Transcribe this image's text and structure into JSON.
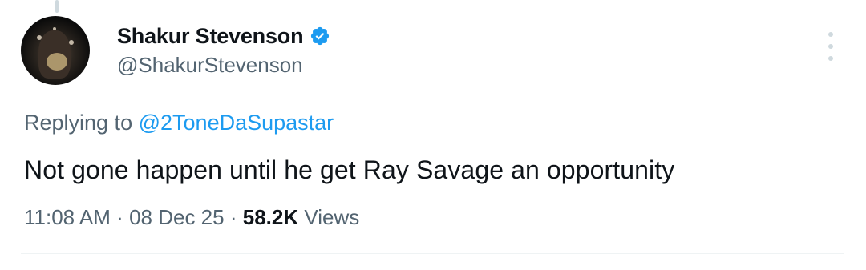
{
  "tweet": {
    "display_name": "Shakur Stevenson",
    "handle": "@ShakurStevenson",
    "replying_prefix": "Replying to",
    "replying_to": "@2ToneDaSupastar",
    "text": "Not gone happen until he get Ray Savage an opportunity",
    "time": "11:08 AM",
    "separator": "·",
    "date": "08 Dec 25",
    "views_count": "58.2K",
    "views_label": "Views",
    "verified_icon": "verified-badge-icon",
    "more_icon": "more-options-icon"
  },
  "colors": {
    "accent": "#1d9bf0",
    "secondary_text": "#536471",
    "primary_text": "#0f1419"
  }
}
